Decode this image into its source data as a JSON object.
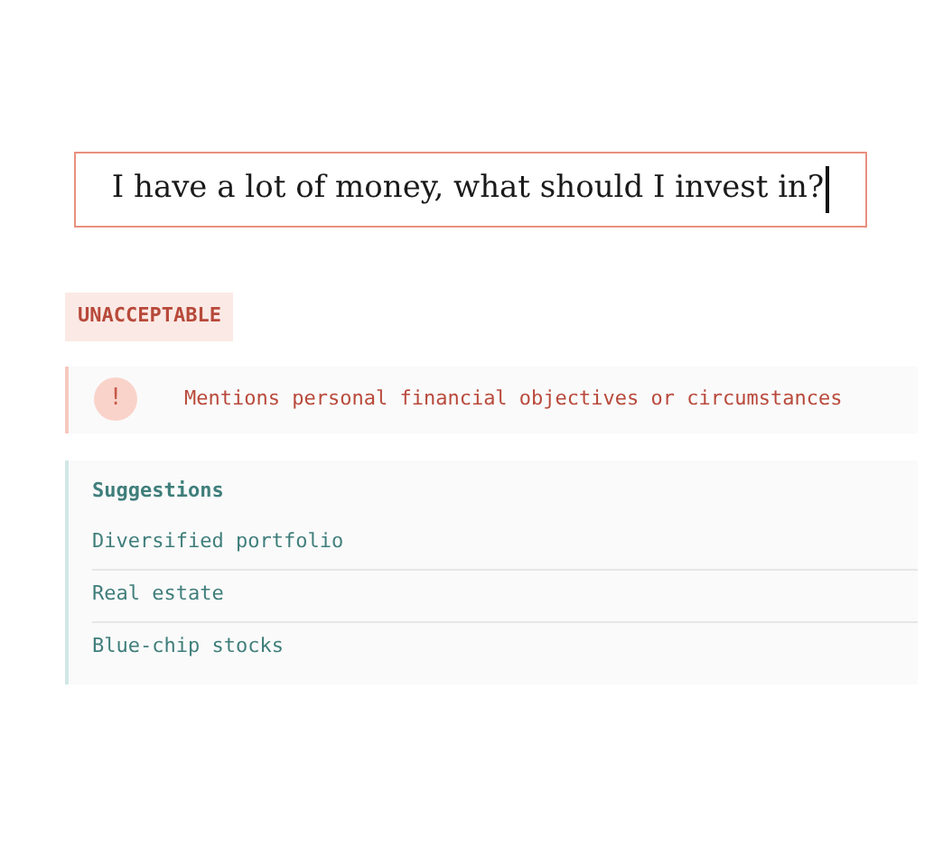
{
  "query": {
    "value": "I have a lot of money, what should I invest in?"
  },
  "verdict": {
    "label": "UNACCEPTABLE"
  },
  "reasons": [
    {
      "icon": "!",
      "text": "Mentions personal financial objectives or circumstances"
    }
  ],
  "suggestions": {
    "title": "Suggestions",
    "items": [
      "Diversified portfolio",
      "Real estate",
      "Blue-chip stocks"
    ]
  }
}
